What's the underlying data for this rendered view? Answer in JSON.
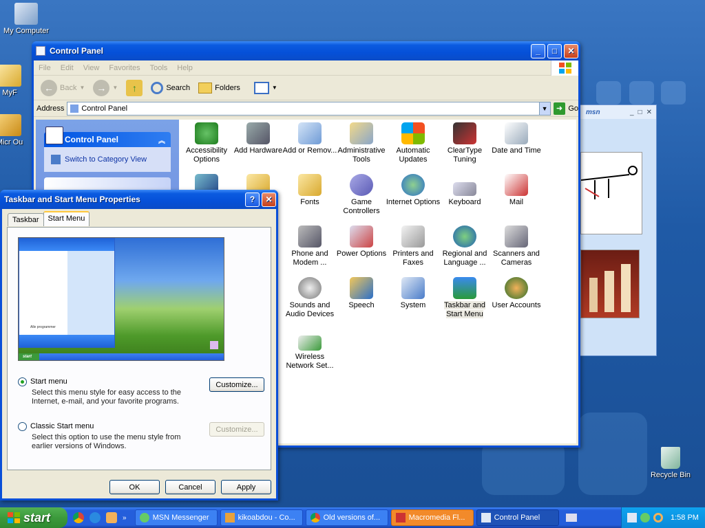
{
  "desktop": {
    "icons": [
      {
        "label": "My Computer"
      },
      {
        "label": "MyF"
      },
      {
        "label": "Micr Ou"
      },
      {
        "label": "Recycle Bin"
      }
    ]
  },
  "control_panel": {
    "title": "Control Panel",
    "menu": [
      "File",
      "Edit",
      "View",
      "Favorites",
      "Tools",
      "Help"
    ],
    "toolbar": {
      "back": "Back",
      "search": "Search",
      "folders": "Folders"
    },
    "address": {
      "label": "Address",
      "value": "Control Panel",
      "go": "Go"
    },
    "sidebar": {
      "header": "Control Panel",
      "link": "Switch to Category View"
    },
    "items": [
      {
        "label": "Accessibility Options"
      },
      {
        "label": "Add Hardware"
      },
      {
        "label": "Add or Remov..."
      },
      {
        "label": "Administrative Tools"
      },
      {
        "label": "Automatic Updates"
      },
      {
        "label": "ClearType Tuning"
      },
      {
        "label": "Date and Time"
      },
      {
        "label": "Fonts"
      },
      {
        "label": "Game Controllers"
      },
      {
        "label": "Internet Options"
      },
      {
        "label": "Keyboard"
      },
      {
        "label": "Mail"
      },
      {
        "label": "Phone and Modem ..."
      },
      {
        "label": "Power Options"
      },
      {
        "label": "Printers and Faxes"
      },
      {
        "label": "Regional and Language ..."
      },
      {
        "label": "Scanners and Cameras"
      },
      {
        "label": "Sounds and Audio Devices"
      },
      {
        "label": "Speech"
      },
      {
        "label": "System"
      },
      {
        "label": "Taskbar and Start Menu"
      },
      {
        "label": "User Accounts"
      },
      {
        "label": "Wireless Network Set..."
      }
    ]
  },
  "msn": {
    "logo": "msn"
  },
  "dialog": {
    "title": "Taskbar and Start Menu Properties",
    "tabs": [
      "Taskbar",
      "Start Menu"
    ],
    "preview": {
      "start_label": "start",
      "all_programs": "Alle programmer"
    },
    "option1": {
      "label": "Start menu",
      "desc": "Select this menu style for easy access to the Internet, e-mail, and your favorite programs.",
      "button": "Customize..."
    },
    "option2": {
      "label": "Classic Start menu",
      "desc": "Select this option to use the menu style from earlier versions of Windows.",
      "button": "Customize..."
    },
    "buttons": {
      "ok": "OK",
      "cancel": "Cancel",
      "apply": "Apply"
    }
  },
  "taskbar": {
    "start": "start",
    "tasks": [
      {
        "label": "MSN Messenger"
      },
      {
        "label": "kikoabdou - Co..."
      },
      {
        "label": "Old versions of..."
      },
      {
        "label": "Macromedia Fl..."
      },
      {
        "label": "Control Panel"
      }
    ],
    "clock": "1:58 PM"
  }
}
